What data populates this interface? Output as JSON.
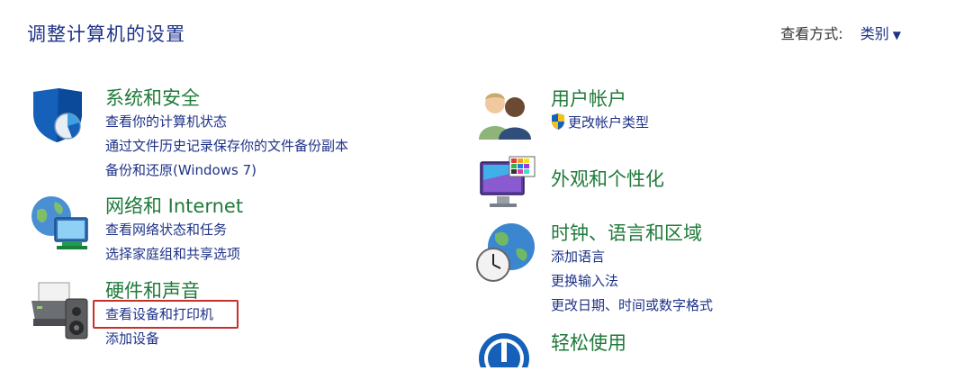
{
  "header": {
    "title": "调整计算机的设置",
    "view_by_label": "查看方式:",
    "view_by_value": "类别"
  },
  "left_categories": [
    {
      "title": "系统和安全",
      "links": [
        "查看你的计算机状态",
        "通过文件历史记录保存你的文件备份副本",
        "备份和还原(Windows 7)"
      ]
    },
    {
      "title": "网络和 Internet",
      "links": [
        "查看网络状态和任务",
        "选择家庭组和共享选项"
      ]
    },
    {
      "title": "硬件和声音",
      "links": [
        "查看设备和打印机",
        "添加设备"
      ]
    }
  ],
  "right_categories": [
    {
      "title": "用户帐户",
      "links": [
        "更改帐户类型"
      ]
    },
    {
      "title": "外观和个性化",
      "links": []
    },
    {
      "title": "时钟、语言和区域",
      "links": [
        "添加语言",
        "更换输入法",
        "更改日期、时间或数字格式"
      ]
    },
    {
      "title": "轻松使用",
      "links": []
    }
  ],
  "colors": {
    "title_link": "#1e3287",
    "category_title": "#1f7a3a",
    "highlight_box": "#c9302c"
  },
  "icons": {
    "system_security": "shield-icon",
    "network": "network-globe-icon",
    "hardware": "printer-icon",
    "user_accounts": "users-icon",
    "appearance": "monitor-palette-icon",
    "clock_language": "clock-globe-icon",
    "ease_of_access": "ease-of-access-icon"
  }
}
